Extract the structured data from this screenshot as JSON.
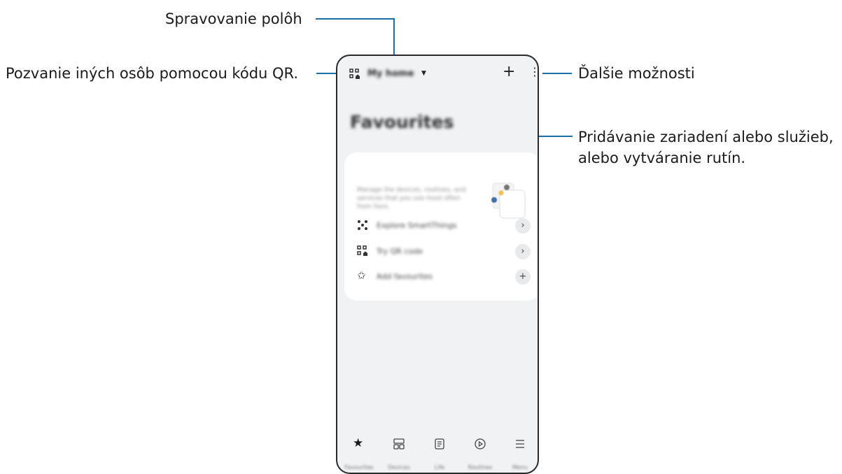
{
  "callouts": {
    "manage_places": "Spravovanie polôh",
    "invite_qr": "Pozvanie iných osôb pomocou kódu QR.",
    "more_options": "Ďalšie možnosti",
    "add_devices_line1": "Pridávanie zariadení alebo služieb,",
    "add_devices_line2": "alebo vytváranie rutín."
  },
  "app": {
    "location_name": "My home",
    "add_symbol": "+",
    "more_symbol": "⋮",
    "favourites_title": "Favourites",
    "card_description": "Manage the devices, routines, and services that you use most often from here.",
    "rows": [
      {
        "label": "Explore SmartThings",
        "action": "›",
        "icon": "smartthings-icon"
      },
      {
        "label": "Try QR code",
        "action": "›",
        "icon": "qr-home-icon"
      },
      {
        "label": "Add favourites",
        "action": "+",
        "icon": "star-outline-icon"
      }
    ],
    "bottom_nav": [
      {
        "label": "Favourites",
        "icon": "star-icon",
        "active": true
      },
      {
        "label": "Devices",
        "icon": "devices-icon",
        "active": false
      },
      {
        "label": "Life",
        "icon": "life-icon",
        "active": false
      },
      {
        "label": "Routines",
        "icon": "routines-icon",
        "active": false
      },
      {
        "label": "Menu",
        "icon": "menu-icon",
        "active": false
      }
    ]
  },
  "colors": {
    "callout_line": "#1a6fa8",
    "phone_bg": "#f1f2f4"
  }
}
